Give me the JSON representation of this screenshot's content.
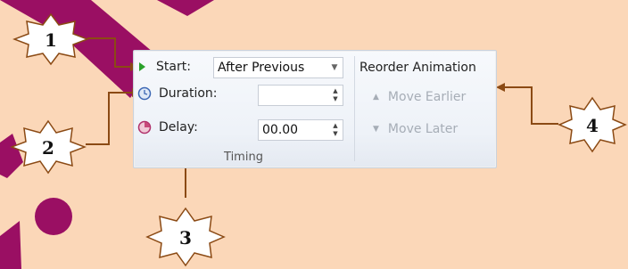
{
  "timing": {
    "start_label": "Start:",
    "start_value": "After Previous",
    "duration_label": "Duration:",
    "duration_value": "",
    "delay_label": "Delay:",
    "delay_value": "00.00",
    "group_label": "Timing"
  },
  "reorder": {
    "title": "Reorder Animation",
    "move_earlier": "Move Earlier",
    "move_later": "Move Later"
  },
  "callouts": [
    "1",
    "2",
    "3",
    "4"
  ],
  "colors": {
    "background": "#fbd7b8",
    "callout_line": "#8b4a14",
    "deco": "#9a0f63"
  }
}
